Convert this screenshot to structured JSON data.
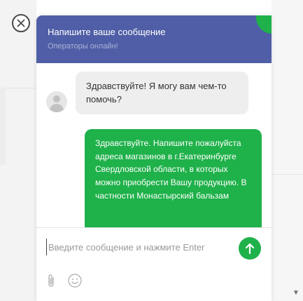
{
  "chat": {
    "header": {
      "title": "Напишите ваше сообщение",
      "subtitle": "Операторы онлайн!"
    },
    "messages": [
      {
        "from": "operator",
        "text": "Здравствуйте! Я могу вам чем-то помочь?"
      },
      {
        "from": "user",
        "text": "Здравствуйте. Напишите пожалуйста адреса магазинов в г.Екатеринбурге Свердловской области, в которых можно приобрести Вашу продукцию. В частности Монастырский бальзам"
      }
    ],
    "input": {
      "placeholder": "Введите сообщение и нажмите Enter",
      "value": ""
    },
    "icons": {
      "close": "close-icon",
      "send": "send-arrow-icon",
      "attach": "paperclip-icon",
      "emoji": "smiley-icon",
      "avatar": "user-avatar-icon",
      "scroll": "chevron-down-icon"
    },
    "colors": {
      "header": "#4f5ea6",
      "accent": "#1fb14a",
      "incoming_bubble": "#eeeeee"
    }
  }
}
